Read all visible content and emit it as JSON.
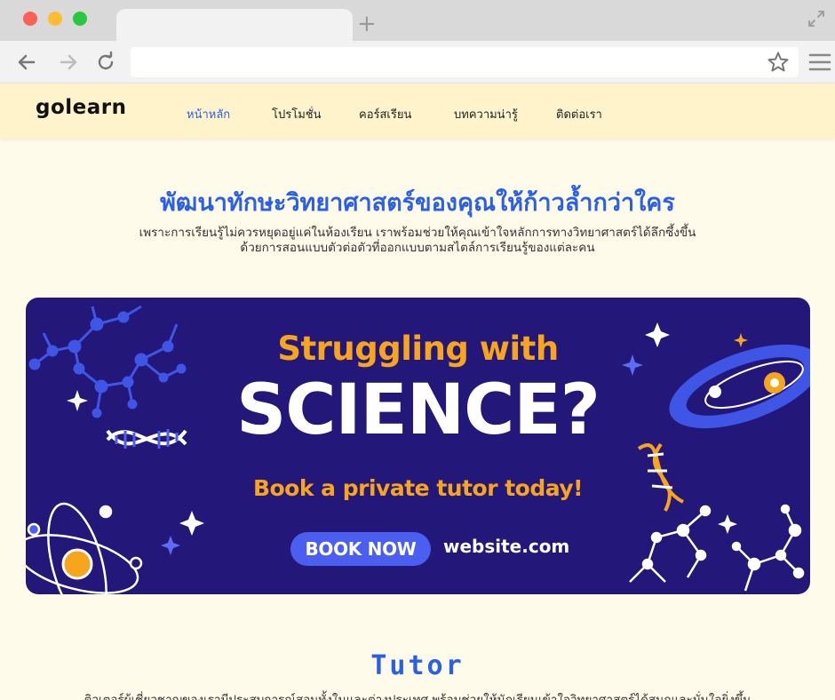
{
  "browser": {
    "new_tab_symbol": "+",
    "address_value": ""
  },
  "site": {
    "logo": "golearn",
    "nav": [
      {
        "label": "หน้าหลัก",
        "active": true
      },
      {
        "label": "โปรโมชั่น",
        "active": false
      },
      {
        "label": "คอร์สเรียน",
        "active": false
      },
      {
        "label": "บทความน่ารู้",
        "active": false
      },
      {
        "label": "ติดต่อเรา",
        "active": false
      }
    ]
  },
  "hero": {
    "title": "พัฒนาทักษะวิทยาศาสตร์ของคุณให้ก้าวล้ำกว่าใคร",
    "subtitle_line1": "เพราะการเรียนรู้ไม่ควรหยุดอยู่แค่ในห้องเรียน เราพร้อมช่วยให้คุณเข้าใจหลักการทางวิทยาศาสตร์ได้ลึกซึ้งขึ้น",
    "subtitle_line2": "ด้วยการสอนแบบตัวต่อตัวที่ออกแบบตามสไตล์การเรียนรู้ของแต่ละคน"
  },
  "banner": {
    "line1": "Struggling with",
    "line2": "SCIENCE?",
    "line3": "Book a private tutor today!",
    "button": "BOOK NOW",
    "website": "website.com",
    "colors": {
      "background": "#24177a",
      "accent": "#f7a51c",
      "button": "#4a5ef0"
    }
  },
  "tutor": {
    "title": "Tutor",
    "subtitle": "ติวเตอร์ผู้เชี่ยวชาญของเรามีประสบการณ์สอนทั้งในและต่างประเทศ พร้อมช่วยให้นักเรียนเข้าใจวิทยาศาสตร์ได้สนุกและมั่นใจยิ่งขึ้น"
  }
}
